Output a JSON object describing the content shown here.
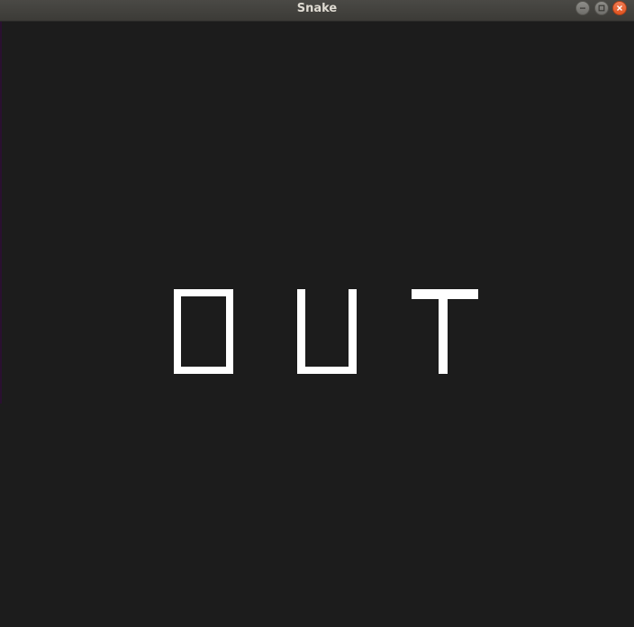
{
  "window": {
    "title": "Snake",
    "colors": {
      "background": "#1c1c1c",
      "text": "#ffffff",
      "close_button": "#e95420"
    }
  },
  "game": {
    "message": "OUT",
    "letters": [
      "O",
      "U",
      "T"
    ]
  },
  "icons": {
    "minimize": "minimize-icon",
    "maximize": "maximize-icon",
    "close": "close-icon"
  }
}
